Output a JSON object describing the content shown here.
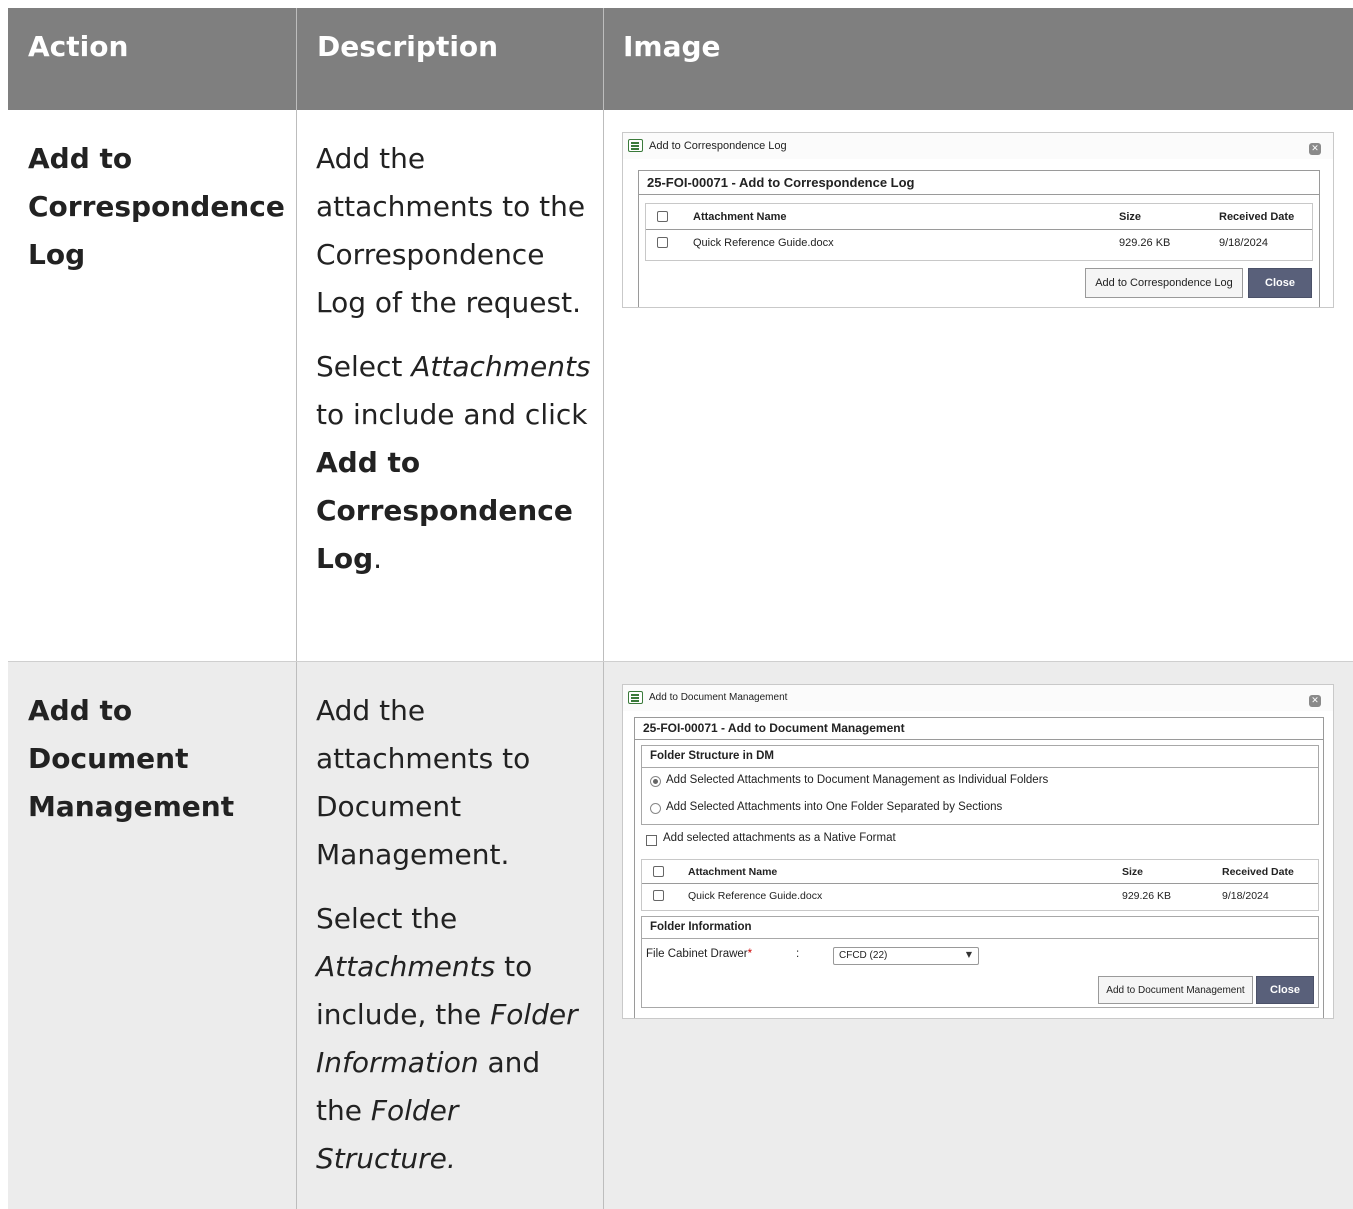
{
  "header": {
    "action": "Action",
    "description": "Description",
    "image": "Image"
  },
  "rows": [
    {
      "action": [
        "Add to",
        "Correspondence",
        "Log"
      ],
      "description": {
        "p1": "Add the attachments to the Correspondence Log of the request.",
        "p2_pre": "Select ",
        "p2_italic": "Attachments",
        "p2_mid": " to include and click ",
        "p2_bold": "Add to Correspondence Log",
        "p2_post": "."
      },
      "dialog": {
        "title": "Add to Correspondence Log",
        "panel_title": "25-FOI-00071 - Add to Correspondence Log",
        "columns": [
          "Attachment Name",
          "Size",
          "Received Date"
        ],
        "file": {
          "name": "Quick Reference Guide.docx",
          "size": "929.26 KB",
          "date": "9/18/2024"
        },
        "primary_button": "Add to Correspondence Log",
        "close_button": "Close",
        "close_icon": "close-icon"
      }
    },
    {
      "action": [
        "Add to",
        "Document",
        "Management"
      ],
      "description": {
        "p1": "Add the attachments to Document Management.",
        "p2_pre": "Select the ",
        "p2_italic1": "Attachments",
        "p2_mid1": " to include, the ",
        "p2_italic2": "Folder Information",
        "p2_mid2": " and the ",
        "p2_italic3": "Folder Structure."
      },
      "dialog": {
        "title": "Add to Document Management",
        "panel_title": "25-FOI-00071 - Add to Document Management",
        "folder_structure_title": "Folder Structure in DM",
        "radio1": "Add Selected Attachments to Document Management as Individual Folders",
        "radio2": "Add Selected Attachments into One Folder Separated by Sections",
        "native_format": "Add selected attachments as a Native Format",
        "columns": [
          "Attachment Name",
          "Size",
          "Received Date"
        ],
        "file": {
          "name": "Quick Reference Guide.docx",
          "size": "929.26 KB",
          "date": "9/18/2024"
        },
        "folder_info_title": "Folder Information",
        "drawer_label": "File Cabinet Drawer",
        "drawer_required": "*",
        "drawer_colon": ":",
        "drawer_value": "CFCD (22)",
        "primary_button": "Add to Document Management",
        "close_button": "Close",
        "close_icon": "close-icon"
      }
    }
  ],
  "colors": {
    "header_bg": "#7f7f7f",
    "row2_bg": "#ececec",
    "close_button_bg": "#59607a"
  }
}
